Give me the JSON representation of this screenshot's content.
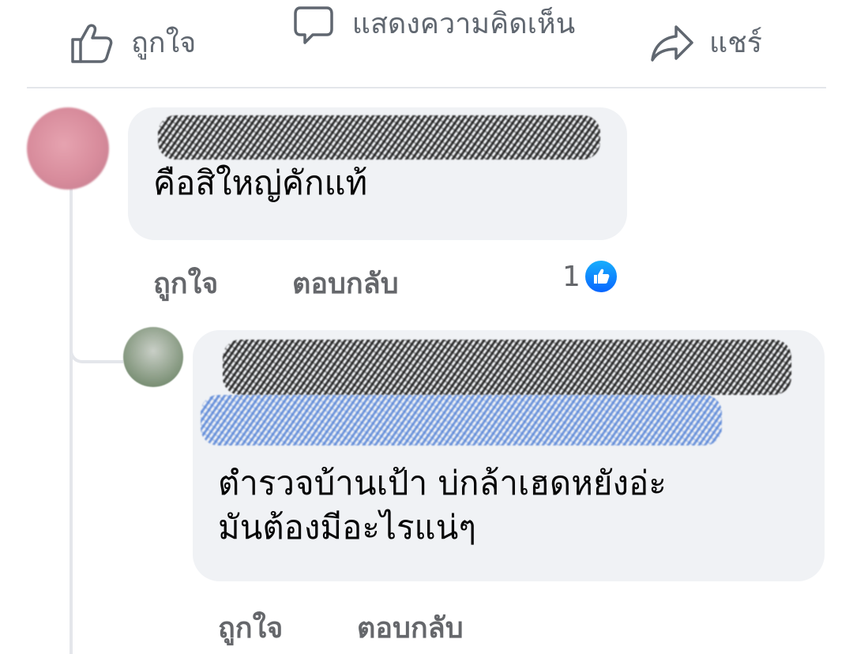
{
  "action_bar": {
    "like_label": "ถูกใจ",
    "comment_label": "แสดงความคิดเห็น",
    "share_label": "แชร์"
  },
  "comments": [
    {
      "author": "",
      "text": "คือสิใหญ่คักแท้",
      "like_label": "ถูกใจ",
      "reply_label": "ตอบกลับ",
      "reaction_count": "1",
      "reaction_icon": "like-reaction-icon"
    },
    {
      "author": "",
      "text_lines": [
        "ตำรวจบ้านเป้า บ่กล้าเฮดหยังอ่ะ",
        "มันต้องมีอะไรแน่ๆ"
      ],
      "like_label": "ถูกใจ",
      "reply_label": "ตอบกลับ"
    }
  ],
  "colors": {
    "meta_text": "#65676b",
    "bubble_bg": "#f0f2f5",
    "reaction_blue": "#0866ff"
  }
}
